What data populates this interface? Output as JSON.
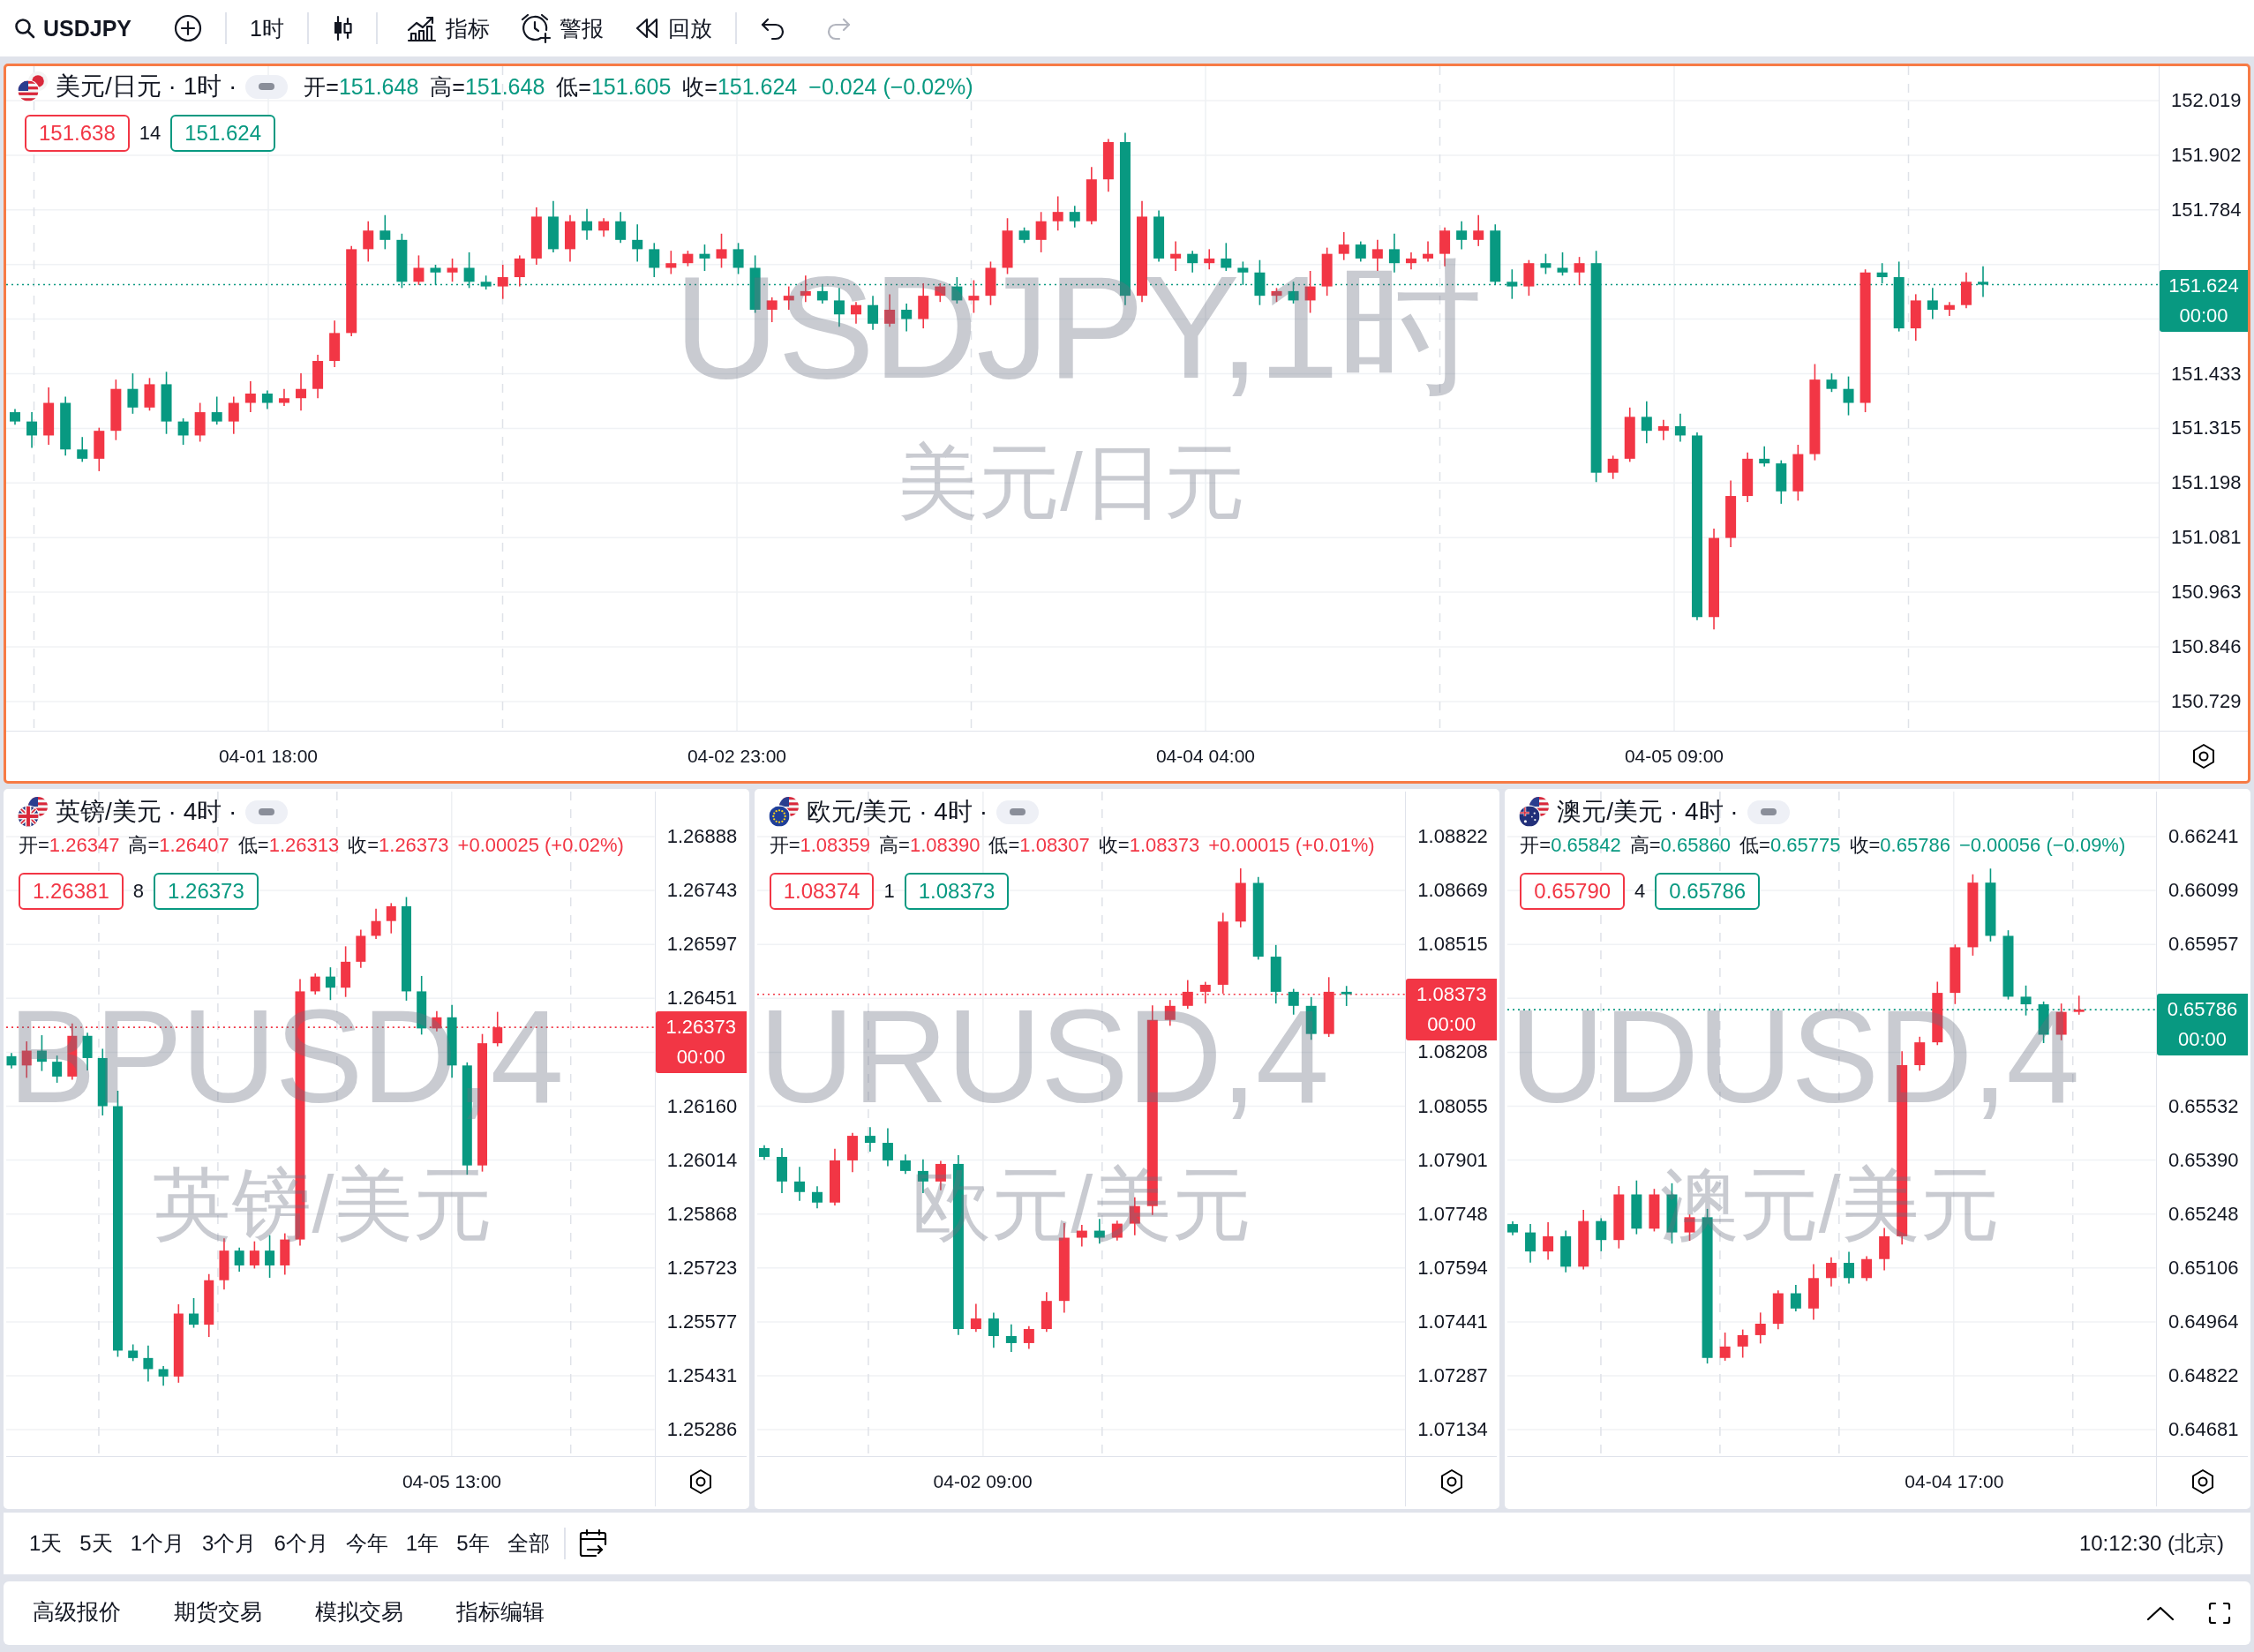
{
  "toolbar": {
    "symbol": "USDJPY",
    "interval": "1时",
    "tools": [
      {
        "kind": "indicators",
        "label": "指标"
      },
      {
        "kind": "alerts",
        "label": "警报"
      },
      {
        "kind": "replay",
        "label": "回放"
      }
    ],
    "history": [
      {
        "kind": "undo",
        "disabled": false
      },
      {
        "kind": "redo",
        "disabled": true
      }
    ]
  },
  "charts": [
    {
      "title": "美元/日元 · 1时 ·",
      "selected": true,
      "rising": false,
      "ohlc": [
        {
          "label": "开=",
          "value": "151.648"
        },
        {
          "label": "高=",
          "value": "151.648"
        },
        {
          "label": "低=",
          "value": "151.605"
        },
        {
          "label": "收=",
          "value": "151.624"
        }
      ],
      "change": "−0.024 (−0.02%)",
      "quote": {
        "sell": "151.638",
        "spread": "14",
        "buy": "151.624"
      },
      "watermark": {
        "symbol": "USDJPY,1时",
        "name": "美元/日元"
      },
      "price_axis": [
        "152.019",
        "151.902",
        "151.784",
        "151.433",
        "151.315",
        "151.198",
        "151.081",
        "150.963",
        "150.846",
        "150.729"
      ],
      "price_tag": {
        "price": "151.624",
        "countdown": "00:00"
      },
      "time_axis": [
        "04-01 18:00",
        "04-02 23:00",
        "04-04 04:00",
        "04-05 09:00"
      ]
    },
    {
      "title": "英镑/美元 · 4时 ·",
      "selected": false,
      "rising": true,
      "ohlc": [
        {
          "label": "开=",
          "value": "1.26347"
        },
        {
          "label": "高=",
          "value": "1.26407"
        },
        {
          "label": "低=",
          "value": "1.26313"
        },
        {
          "label": "收=",
          "value": "1.26373"
        }
      ],
      "change": "+0.00025 (+0.02%)",
      "quote": {
        "sell": "1.26381",
        "spread": "8",
        "buy": "1.26373"
      },
      "watermark": {
        "symbol": "BPUSD,4",
        "name": "英镑/美元"
      },
      "price_axis": [
        "1.26888",
        "1.26743",
        "1.26597",
        "1.26451",
        "1.26160",
        "1.26014",
        "1.25868",
        "1.25723",
        "1.25577",
        "1.25431",
        "1.25286"
      ],
      "price_tag": {
        "price": "1.26373",
        "countdown": "00:00"
      },
      "time_axis": [
        "04-05 13:00"
      ]
    },
    {
      "title": "欧元/美元 · 4时 ·",
      "selected": false,
      "rising": true,
      "ohlc": [
        {
          "label": "开=",
          "value": "1.08359"
        },
        {
          "label": "高=",
          "value": "1.08390"
        },
        {
          "label": "低=",
          "value": "1.08307"
        },
        {
          "label": "收=",
          "value": "1.08373"
        }
      ],
      "change": "+0.00015 (+0.01%)",
      "quote": {
        "sell": "1.08374",
        "spread": "1",
        "buy": "1.08373"
      },
      "watermark": {
        "symbol": "URUSD,4",
        "name": "欧元/美元"
      },
      "price_axis": [
        "1.08822",
        "1.08669",
        "1.08515",
        "1.08208",
        "1.08055",
        "1.07901",
        "1.07748",
        "1.07594",
        "1.07441",
        "1.07287",
        "1.07134"
      ],
      "price_tag": {
        "price": "1.08373",
        "countdown": "00:00"
      },
      "time_axis": [
        "04-02 09:00"
      ]
    },
    {
      "title": "澳元/美元 · 4时 ·",
      "selected": false,
      "rising": false,
      "ohlc": [
        {
          "label": "开=",
          "value": "0.65842"
        },
        {
          "label": "高=",
          "value": "0.65860"
        },
        {
          "label": "低=",
          "value": "0.65775"
        },
        {
          "label": "收=",
          "value": "0.65786"
        }
      ],
      "change": "−0.00056 (−0.09%)",
      "quote": {
        "sell": "0.65790",
        "spread": "4",
        "buy": "0.65786"
      },
      "watermark": {
        "symbol": "UDUSD,4",
        "name": "澳元/美元"
      },
      "price_axis": [
        "0.66241",
        "0.66099",
        "0.65957",
        "0.65532",
        "0.65390",
        "0.65248",
        "0.65106",
        "0.64964",
        "0.64822",
        "0.64681"
      ],
      "price_tag": {
        "price": "0.65786",
        "countdown": "00:00"
      },
      "time_axis": [
        "04-04 17:00"
      ]
    }
  ],
  "range_bar": {
    "ranges": [
      {
        "label": "1天",
        "selected": false
      },
      {
        "label": "5天",
        "selected": false
      },
      {
        "label": "1个月",
        "selected": false
      },
      {
        "label": "3个月",
        "selected": false
      },
      {
        "label": "6个月",
        "selected": false
      },
      {
        "label": "今年",
        "selected": false
      },
      {
        "label": "1年",
        "selected": false
      },
      {
        "label": "5年",
        "selected": false
      },
      {
        "label": "全部",
        "selected": false
      }
    ],
    "clock": "10:12:30 (北京)"
  },
  "bottom_panel": {
    "tabs": [
      {
        "label": "高级报价",
        "selected": false
      },
      {
        "label": "期货交易",
        "selected": false
      },
      {
        "label": "模拟交易",
        "selected": false
      },
      {
        "label": "指标编辑",
        "selected": false
      }
    ]
  }
}
